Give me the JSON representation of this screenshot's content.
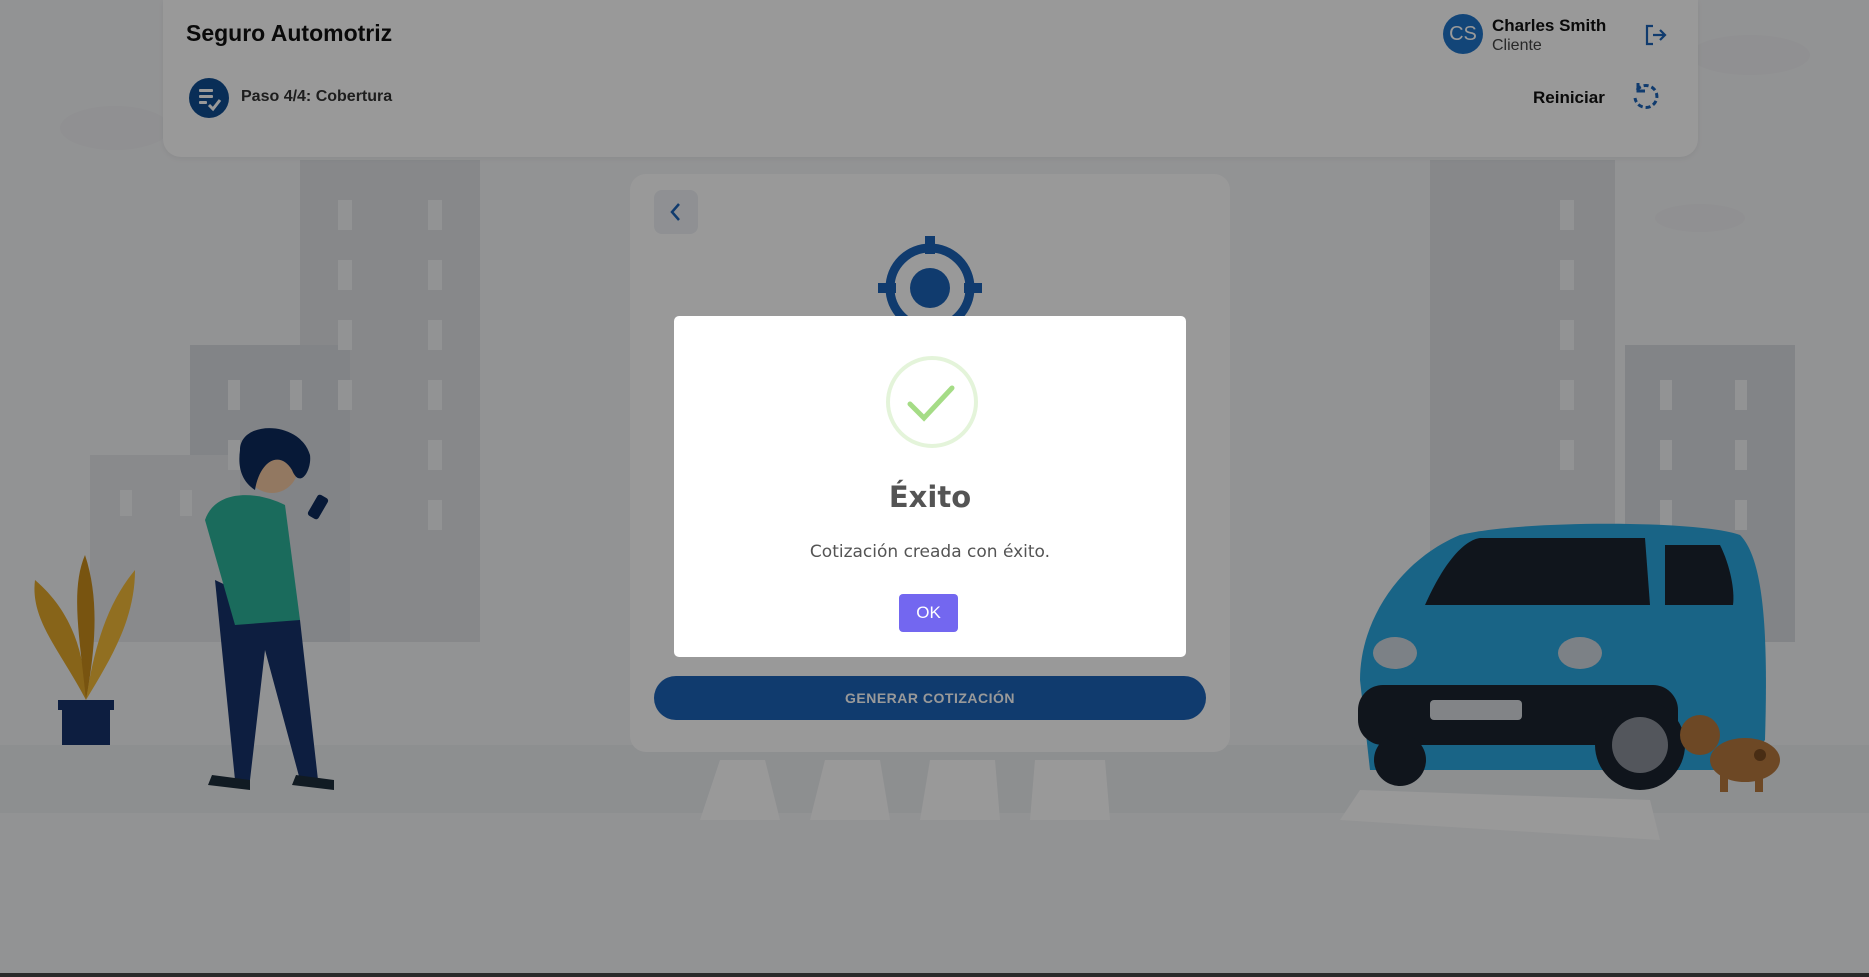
{
  "header": {
    "title": "Seguro Automotriz",
    "step_label": "Paso 4/4: Cobertura",
    "restart_label": "Reiniciar",
    "user": {
      "initials": "CS",
      "name": "Charles Smith",
      "role": "Cliente"
    }
  },
  "panel": {
    "generate_button_label": "GENERAR COTIZACIÓN"
  },
  "modal": {
    "title": "Éxito",
    "message": "Cotización creada con éxito.",
    "ok_label": "OK"
  },
  "colors": {
    "brand_blue": "#0f4d92",
    "accent_purple": "#7367f0",
    "success_green": "#a5dc86",
    "car_blue": "#2aa7df"
  }
}
